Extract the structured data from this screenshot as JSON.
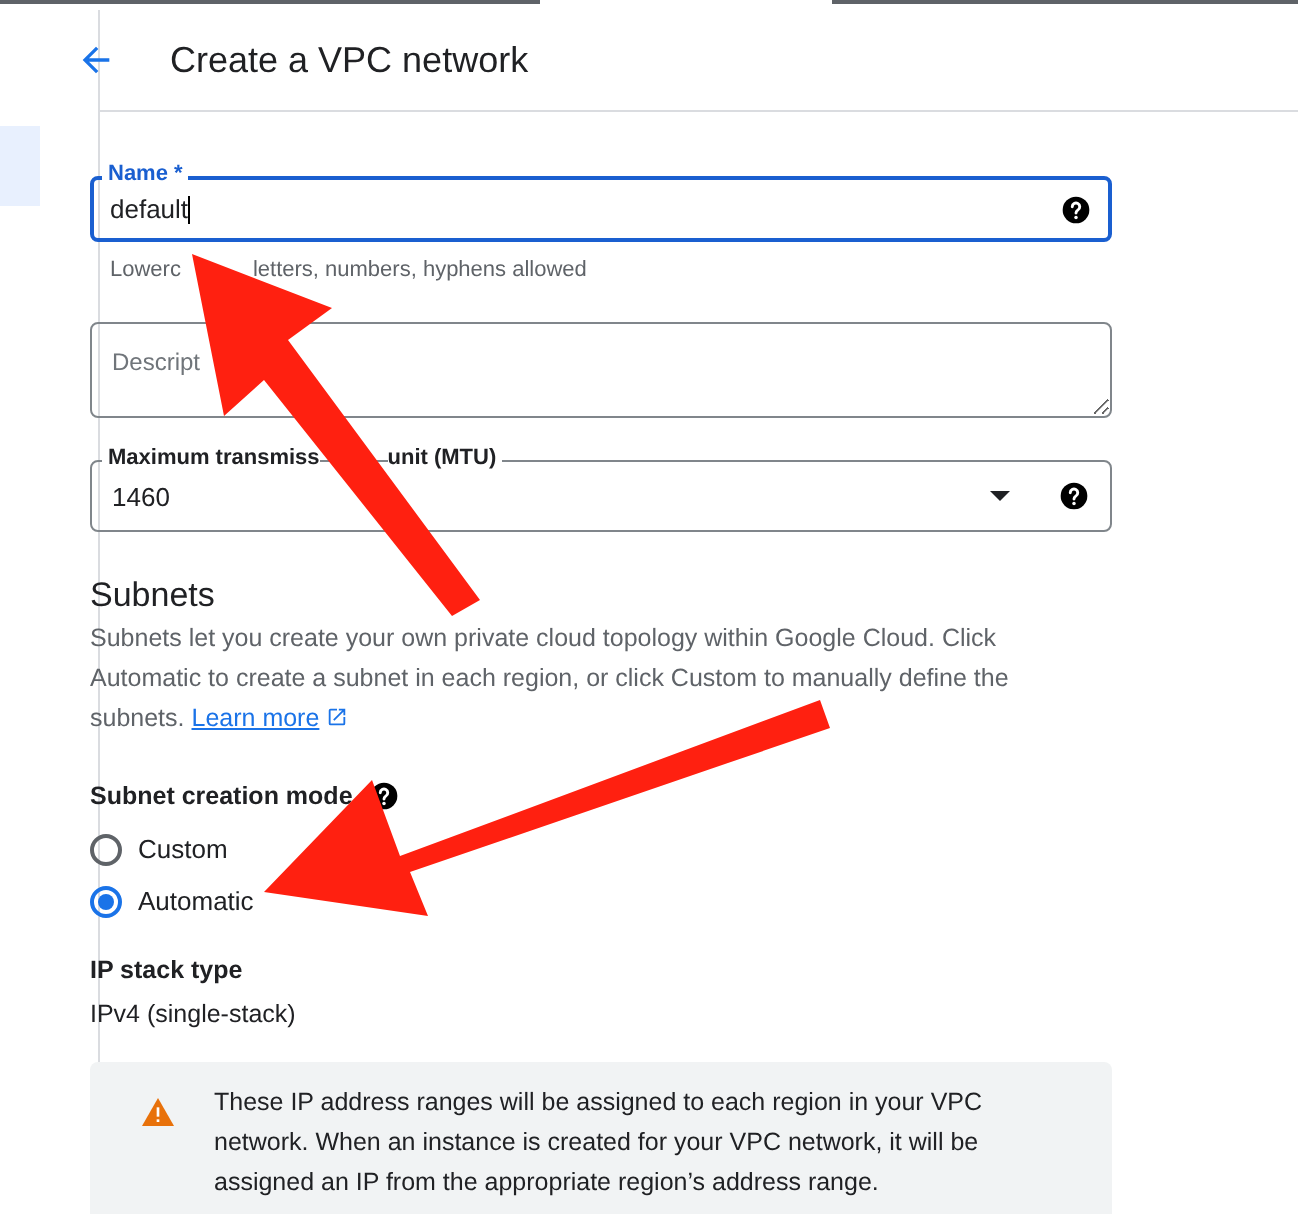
{
  "header": {
    "title": "Create a VPC network"
  },
  "name_field": {
    "label": "Name *",
    "value": "default",
    "hint": [
      "Lowerc",
      "letters, numbers, hyphens allowed"
    ]
  },
  "description_field": {
    "placeholder": "Descript"
  },
  "mtu_field": {
    "label": [
      "Maximum transmiss",
      "unit (MTU)"
    ],
    "value": "1460"
  },
  "subnets": {
    "heading": "Subnets",
    "text": "Subnets let you create your own private cloud topology within Google Cloud. Click Automatic to create a subnet in each region, or click Custom to manually define the subnets.",
    "link": "Learn more"
  },
  "subnet_mode": {
    "label": "Subnet creation mode",
    "options": [
      {
        "label": "Custom",
        "selected": false
      },
      {
        "label": "Automatic",
        "selected": true
      }
    ]
  },
  "ip_stack": {
    "label": "IP stack type",
    "value": "IPv4 (single-stack)"
  },
  "warning": {
    "text": "These IP address ranges will be assigned to each region in your VPC network. When an instance is created for your VPC network, it will be assigned an IP from the appropriate region’s address range."
  }
}
